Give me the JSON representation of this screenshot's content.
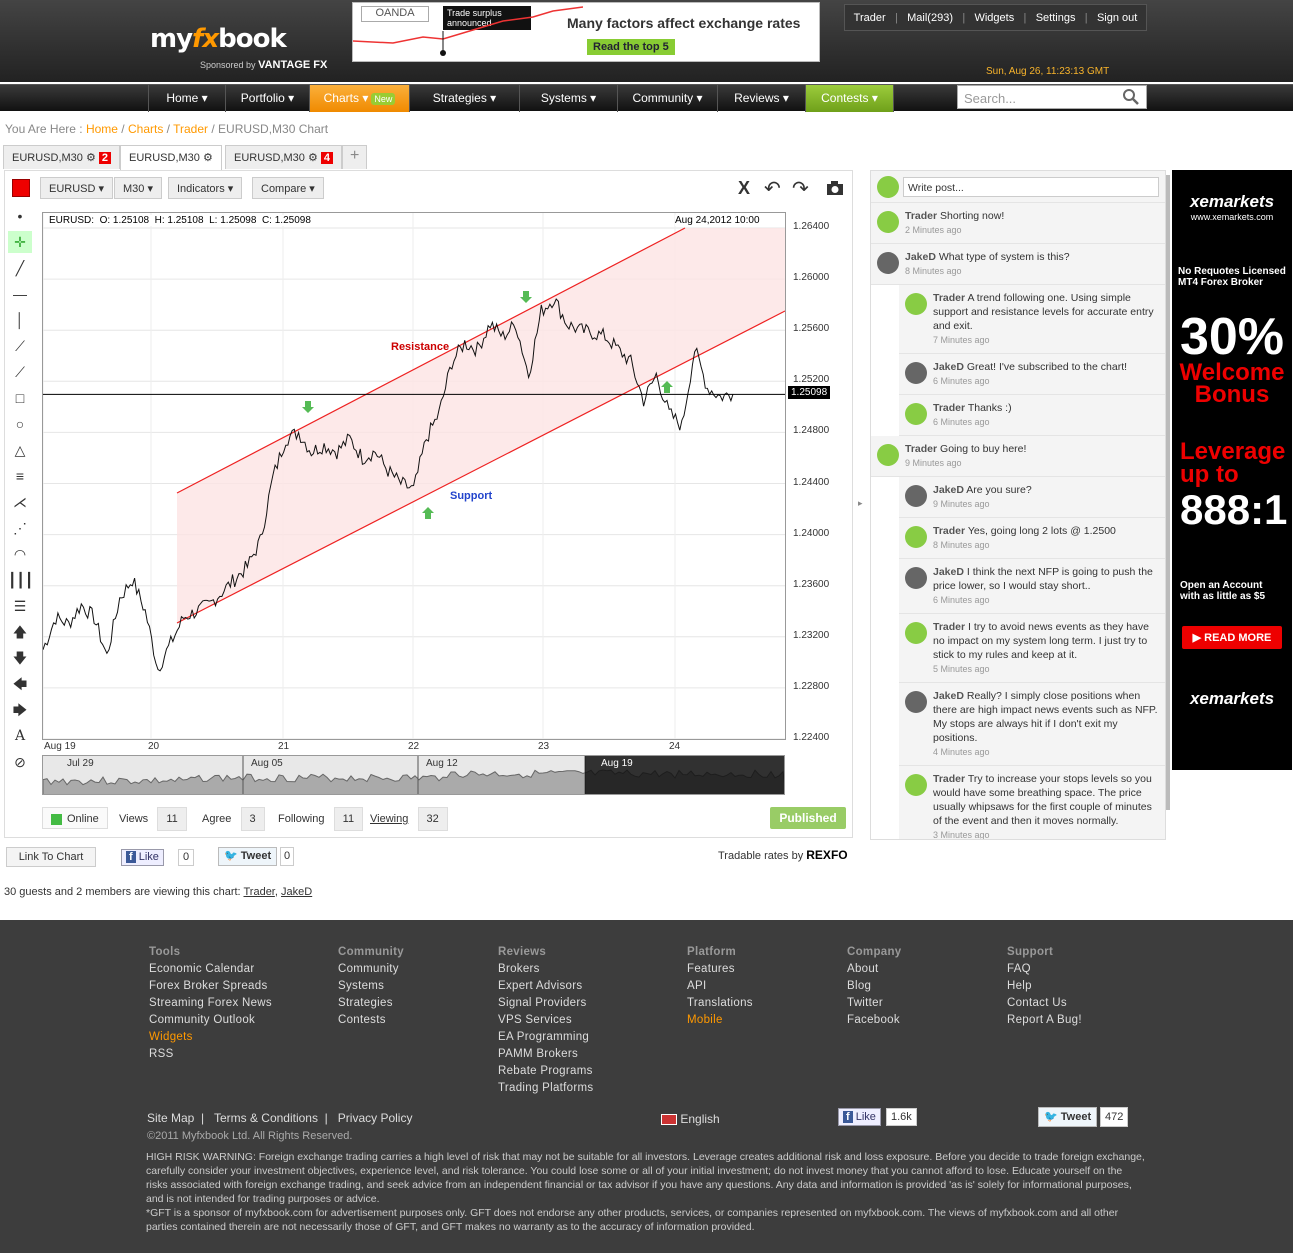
{
  "header": {
    "logo_a": "my",
    "logo_fx": "fx",
    "logo_b": "book",
    "sponsored_by": "Sponsored by",
    "sponsor_name": "VANTAGE FX",
    "datetime": "Sun, Aug 26, 11:23:13 GMT"
  },
  "banner": {
    "brand": "OANDA",
    "news": "Trade surplus announced",
    "headline": "Many factors affect exchange rates",
    "cta": "Read the top 5"
  },
  "topnav": [
    "Trader",
    "Mail(293)",
    "Widgets",
    "Settings",
    "Sign out"
  ],
  "mainnav": [
    {
      "label": "Home ▾"
    },
    {
      "label": "Portfolio ▾"
    },
    {
      "label": "Charts ▾",
      "badge": "New"
    },
    {
      "label": "Strategies ▾"
    },
    {
      "label": "Systems ▾"
    },
    {
      "label": "Community ▾"
    },
    {
      "label": "Reviews ▾"
    },
    {
      "label": "Contests ▾"
    }
  ],
  "search": {
    "placeholder": "Search..."
  },
  "breadcrumb": {
    "prefix": "You Are Here :",
    "items": [
      "Home",
      "Charts",
      "Trader"
    ],
    "current": "EURUSD,M30 Chart"
  },
  "tabs": [
    {
      "label": "EURUSD,M30",
      "badge": "2"
    },
    {
      "label": "EURUSD,M30"
    },
    {
      "label": "EURUSD,M30",
      "badge": "4"
    },
    {
      "label": "+"
    }
  ],
  "chart_toolbar": {
    "symbol": "EURUSD",
    "timeframe": "M30",
    "indicators": "Indicators",
    "compare": "Compare"
  },
  "ohlc": {
    "symbol": "EURUSD:",
    "open": "O: 1.25108",
    "high": "H: 1.25108",
    "low": "L: 1.25098",
    "close": "C: 1.25098",
    "time": "Aug 24,2012 10:00"
  },
  "annotations": {
    "resistance": "Resistance",
    "support": "Support"
  },
  "chart_data": {
    "type": "line",
    "title": "EURUSD,M30",
    "y_ticks": [
      "1.26400",
      "1.26000",
      "1.25600",
      "1.25200",
      "1.24800",
      "1.24400",
      "1.24000",
      "1.23600",
      "1.23200",
      "1.22800",
      "1.22400"
    ],
    "x_ticks": [
      "Aug 19",
      "20",
      "21",
      "22",
      "23",
      "24"
    ],
    "current_price": "1.25098",
    "ylim": [
      1.224,
      1.264
    ],
    "navigator_labels": [
      "Jul 29",
      "Aug 05",
      "Aug 12",
      "Aug 19"
    ],
    "series": [
      {
        "values": [
          1.231,
          1.2335,
          1.233,
          1.2345,
          1.2335,
          1.2305,
          1.235,
          1.2365,
          1.234,
          1.2295,
          1.2315,
          1.2335,
          1.234,
          1.2345,
          1.2355,
          1.2365,
          1.2375,
          1.2395,
          1.2445,
          1.2475,
          1.248,
          1.2465,
          1.247,
          1.2465,
          1.2475,
          1.246,
          1.2465,
          1.245,
          1.244,
          1.2435,
          1.2475,
          1.2495,
          1.2535,
          1.255,
          1.2545,
          1.2565,
          1.2555,
          1.2565,
          1.2525,
          1.2575,
          1.2585,
          1.2565,
          1.256,
          1.2558,
          1.2555,
          1.2545,
          1.2535,
          1.2505,
          1.2525,
          1.2495,
          1.2485,
          1.2545,
          1.2515,
          1.2508,
          1.251
        ]
      }
    ]
  },
  "stats": {
    "online": "Online",
    "views_label": "Views",
    "views": "11",
    "agree_label": "Agree",
    "agree": "3",
    "following_label": "Following",
    "following": "11",
    "viewing_label": "Viewing",
    "viewing": "32",
    "published": "Published"
  },
  "social": {
    "link": "Link To Chart",
    "like": "Like",
    "like_count": "0",
    "tweet": "Tweet",
    "tweet_count": "0",
    "rates": "Tradable rates by",
    "rexfo": "REXFO"
  },
  "guests": {
    "text": "30 guests and 2 members are viewing this chart:",
    "u1": "Trader",
    "u2": "JakeD"
  },
  "feed": {
    "write": "Write post...",
    "posts": [
      {
        "u": "Trader",
        "t": "Shorting now!",
        "m": "2 Minutes ago",
        "r": false,
        "j": false
      },
      {
        "u": "JakeD",
        "t": "What type of system is this?",
        "m": "8 Minutes ago",
        "r": false,
        "j": true
      },
      {
        "u": "Trader",
        "t": "A trend following one. Using simple support and resistance levels for accurate entry and exit.",
        "m": "7 Minutes ago",
        "r": true,
        "j": false
      },
      {
        "u": "JakeD",
        "t": "Great! I've subscribed to the chart!",
        "m": "6 Minutes ago",
        "r": true,
        "j": true
      },
      {
        "u": "Trader",
        "t": "Thanks :)",
        "m": "6 Minutes ago",
        "r": true,
        "j": false
      },
      {
        "u": "Trader",
        "t": "Going to buy here!",
        "m": "9 Minutes ago",
        "r": false,
        "j": false
      },
      {
        "u": "JakeD",
        "t": "Are you sure?",
        "m": "9 Minutes ago",
        "r": true,
        "j": true
      },
      {
        "u": "Trader",
        "t": "Yes, going long 2 lots @ 1.2500",
        "m": "8 Minutes ago",
        "r": true,
        "j": false
      },
      {
        "u": "JakeD",
        "t": "I think the next NFP is going to push the price lower, so I would stay short..",
        "m": "6 Minutes ago",
        "r": true,
        "j": true
      },
      {
        "u": "Trader",
        "t": "I try to avoid news events as they have no impact on my system long term. I just try to stick to my rules and keep at it.",
        "m": "5 Minutes ago",
        "r": true,
        "j": false
      },
      {
        "u": "JakeD",
        "t": "Really? I simply close positions when there are high impact news events such as NFP. My stops are always hit if I don't exit my positions.",
        "m": "4 Minutes ago",
        "r": true,
        "j": true
      },
      {
        "u": "Trader",
        "t": "Try to increase your stops levels so you would have some breathing space. The price usually whipsaws for the first couple of minutes of the event and then it moves normally.",
        "m": "3 Minutes ago",
        "r": true,
        "j": false
      }
    ]
  },
  "ad": {
    "brand": "xemarkets",
    "url": "www.xemarkets.com",
    "l1": "No Requotes Licensed MT4 Forex Broker",
    "pct": "30%",
    "wb1": "Welcome",
    "wb2": "Bonus",
    "lev1": "Leverage",
    "lev2": "up to",
    "lev3": "888:1",
    "open": "Open an Account with as little as $5",
    "btn": "▶ READ MORE",
    "brand2": "xemarkets"
  },
  "footer": {
    "cols": [
      {
        "h": "Tools",
        "items": [
          "Economic Calendar",
          "Forex Broker Spreads",
          "Streaming Forex News",
          "Community Outlook",
          "Widgets",
          "RSS"
        ],
        "hl": 4
      },
      {
        "h": "Community",
        "items": [
          "Community",
          "Systems",
          "Strategies",
          "Contests"
        ],
        "hl": -1
      },
      {
        "h": "Reviews",
        "items": [
          "Brokers",
          "Expert Advisors",
          "Signal Providers",
          "VPS Services",
          "EA Programming",
          "PAMM Brokers",
          "Rebate Programs",
          "Trading Platforms"
        ],
        "hl": -1
      },
      {
        "h": "Platform",
        "items": [
          "Features",
          "API",
          "Translations",
          "Mobile"
        ],
        "hl": 3
      },
      {
        "h": "Company",
        "items": [
          "About",
          "Blog",
          "Twitter",
          "Facebook"
        ],
        "hl": -1
      },
      {
        "h": "Support",
        "items": [
          "FAQ",
          "Help",
          "Contact Us",
          "Report A Bug!"
        ],
        "hl": -1
      }
    ],
    "sitemap": "Site Map",
    "terms": "Terms & Conditions",
    "privacy": "Privacy Policy",
    "lang": "English",
    "fb_like": "Like",
    "fb_count": "1.6k",
    "tw": "Tweet",
    "tw_count": "472",
    "copy": "©2011 Myfxbook Ltd. All Rights Reserved.",
    "warning": "HIGH RISK WARNING: Foreign exchange trading carries a high level of risk that may not be suitable for all investors. Leverage creates additional risk and loss exposure. Before you decide to trade foreign exchange, carefully consider your investment objectives, experience level, and risk tolerance. You could lose some or all of your initial investment; do not invest money that you cannot afford to lose. Educate yourself on the risks associated with foreign exchange trading, and seek advice from an independent financial or tax advisor if you have any questions. Any data and information is provided 'as is' solely for informational purposes, and is not intended for trading purposes or advice.",
    "gft": "*GFT is a sponsor of myfxbook.com for advertisement purposes only. GFT does not endorse any other products, services, or companies represented on myfxbook.com. The views of myfxbook.com and all other parties contained therein are not necessarily those of GFT, and GFT makes no warranty as to the accuracy of information provided."
  }
}
